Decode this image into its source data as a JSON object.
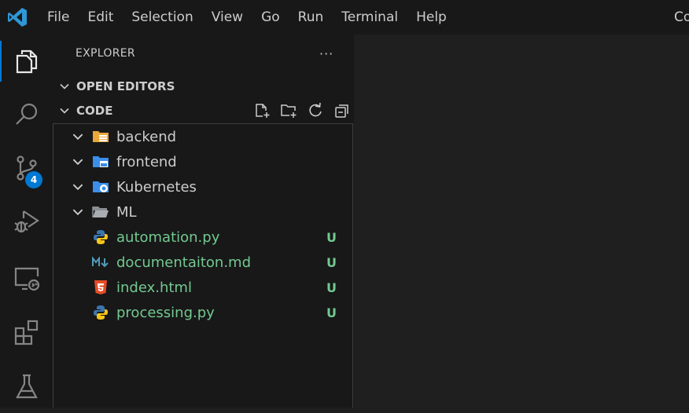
{
  "titlebar": {
    "menu": [
      "File",
      "Edit",
      "Selection",
      "View",
      "Go",
      "Run",
      "Terminal",
      "Help"
    ],
    "window_title": "Co"
  },
  "activity_bar": {
    "items": [
      "explorer-icon",
      "search-icon",
      "source-control-icon",
      "run-debug-icon",
      "remote-explorer-icon",
      "extensions-icon",
      "testing-icon"
    ],
    "source_control_badge": "4",
    "accent": "#0078d4"
  },
  "explorer": {
    "header": "EXPLORER",
    "more": "···",
    "open_editors_label": "OPEN EDITORS",
    "folder_label": "CODE",
    "tree": [
      {
        "label": "backend",
        "type": "folder",
        "icon": "folder-backend-icon"
      },
      {
        "label": "frontend",
        "type": "folder",
        "icon": "folder-frontend-icon"
      },
      {
        "label": "Kubernetes",
        "type": "folder",
        "icon": "folder-kubernetes-icon"
      },
      {
        "label": "ML",
        "type": "folder",
        "icon": "folder-icon"
      },
      {
        "label": "automation.py",
        "type": "file",
        "icon": "python-icon",
        "status": "U"
      },
      {
        "label": "documentaiton.md",
        "type": "file",
        "icon": "markdown-icon",
        "status": "U"
      },
      {
        "label": "index.html",
        "type": "file",
        "icon": "html-icon",
        "status": "U"
      },
      {
        "label": "processing.py",
        "type": "file",
        "icon": "python-icon",
        "status": "U"
      }
    ],
    "untracked_color": "#73c991"
  }
}
